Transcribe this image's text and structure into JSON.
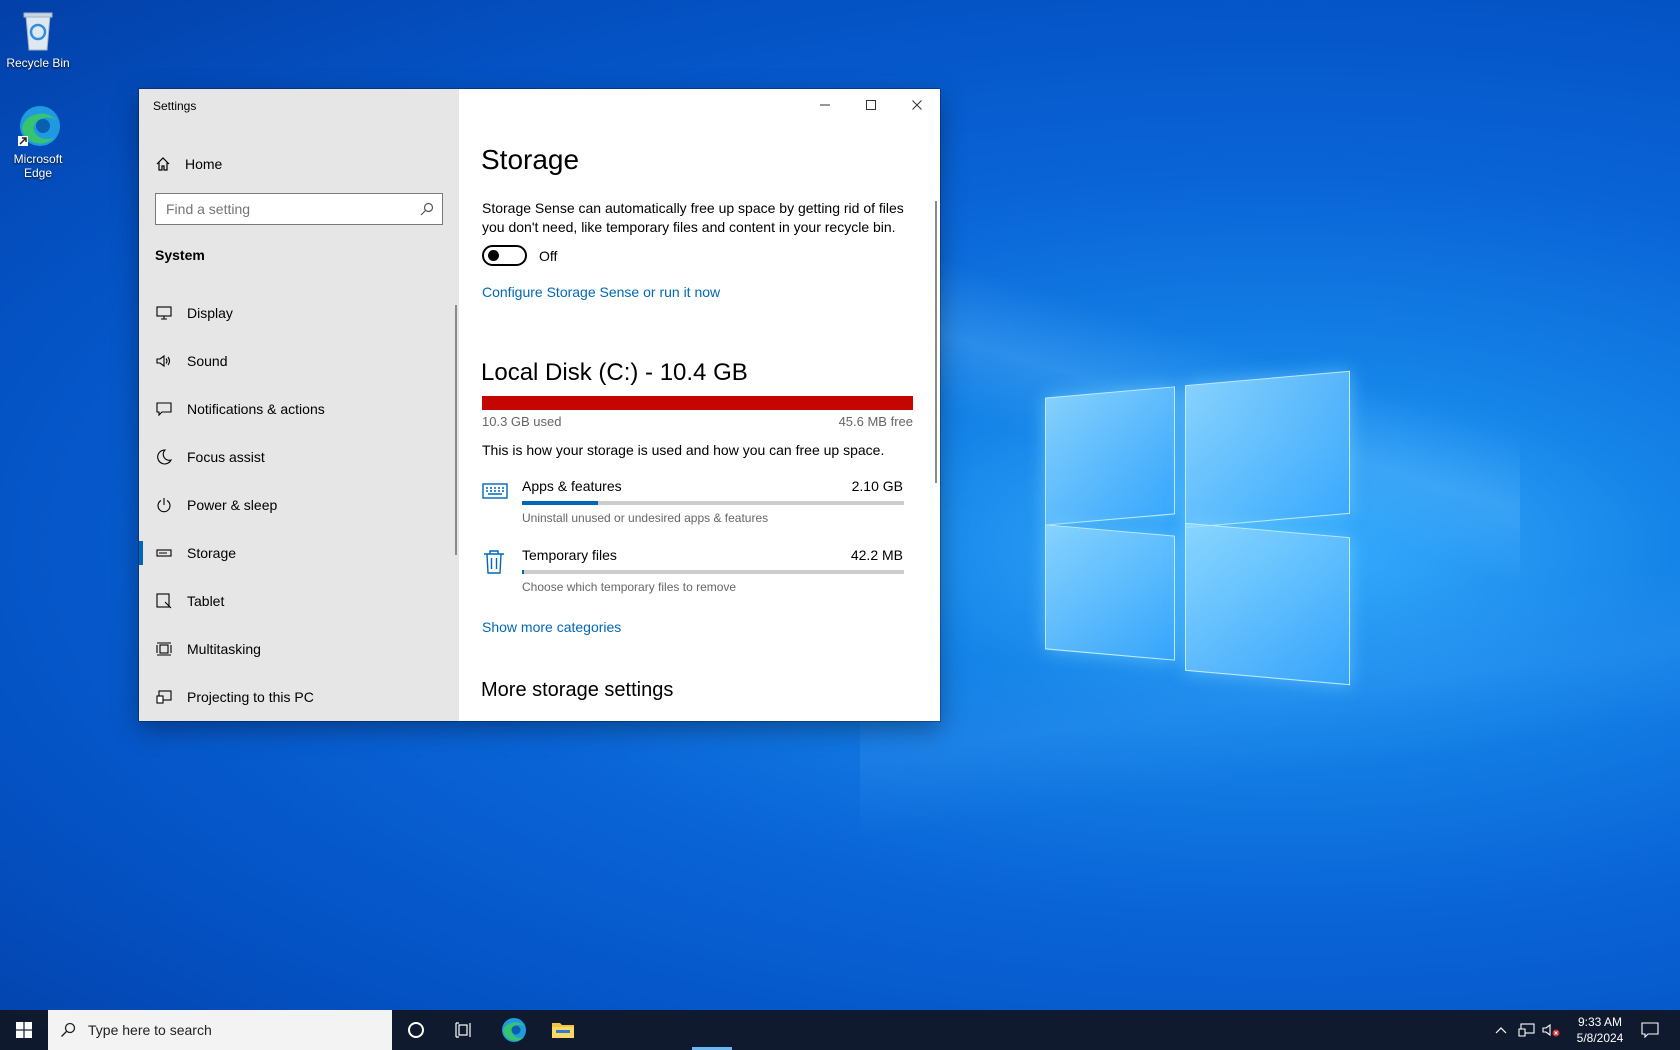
{
  "desktop": {
    "icons": [
      {
        "label": "Recycle Bin"
      },
      {
        "label": "Microsoft Edge"
      }
    ]
  },
  "window": {
    "title": "Settings",
    "sidebar": {
      "home_label": "Home",
      "search_placeholder": "Find a setting",
      "section_label": "System",
      "items": [
        {
          "label": "Display",
          "icon": "monitor-icon"
        },
        {
          "label": "Sound",
          "icon": "speaker-icon"
        },
        {
          "label": "Notifications & actions",
          "icon": "notification-icon"
        },
        {
          "label": "Focus assist",
          "icon": "moon-icon"
        },
        {
          "label": "Power & sleep",
          "icon": "power-icon"
        },
        {
          "label": "Storage",
          "icon": "drive-icon",
          "active": true
        },
        {
          "label": "Tablet",
          "icon": "tablet-icon"
        },
        {
          "label": "Multitasking",
          "icon": "multitasking-icon"
        },
        {
          "label": "Projecting to this PC",
          "icon": "projecting-icon"
        }
      ]
    },
    "content": {
      "title": "Storage",
      "description": "Storage Sense can automatically free up space by getting rid of files you don't need, like temporary files and content in your recycle bin.",
      "toggle_state": "Off",
      "configure_link": "Configure Storage Sense or run it now",
      "disk": {
        "title": "Local Disk (C:) - 10.4 GB",
        "used": "10.3 GB used",
        "free": "45.6 MB free",
        "used_fraction": 0.996,
        "bar_color": "#c50500"
      },
      "usage_note": "This is how your storage is used and how you can free up space.",
      "categories": [
        {
          "name": "Apps & features",
          "size": "2.10 GB",
          "subtitle": "Uninstall unused or undesired apps & features",
          "fraction": 0.2,
          "icon": "apps-icon"
        },
        {
          "name": "Temporary files",
          "size": "42.2 MB",
          "subtitle": "Choose which temporary files to remove",
          "fraction": 0.005,
          "icon": "trash-icon"
        }
      ],
      "show_more_link": "Show more categories",
      "more_settings_title": "More storage settings"
    }
  },
  "taskbar": {
    "search_placeholder": "Type here to search",
    "time": "9:33 AM",
    "date": "5/8/2024"
  },
  "colors": {
    "accent": "#0067b8",
    "disk_full": "#c50500"
  }
}
